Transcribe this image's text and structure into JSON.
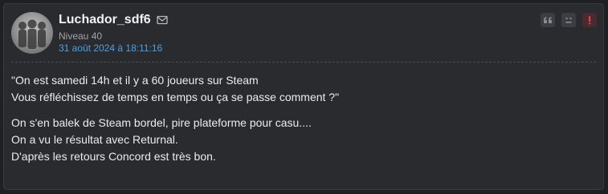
{
  "post": {
    "author": "Luchador_sdf6",
    "level": "Niveau 40",
    "date": "31 août 2024 à 18:11:16",
    "icons": {
      "mail": "envelope-icon",
      "quote": "quote-icon",
      "mp": "sad-face-icon",
      "alert": "alert-icon"
    },
    "colors": {
      "date_link": "#4f9fe3",
      "alert": "#d0454f"
    },
    "paragraphs": [
      [
        "\"On est samedi 14h et il y a 60 joueurs sur Steam",
        "Vous réfléchissez de temps en temps ou ça se passe comment ?\""
      ],
      [
        "On s'en balek de Steam bordel, pire plateforme pour casu....",
        "On a vu le résultat avec Returnal.",
        "D'après les retours Concord est très bon."
      ]
    ]
  }
}
